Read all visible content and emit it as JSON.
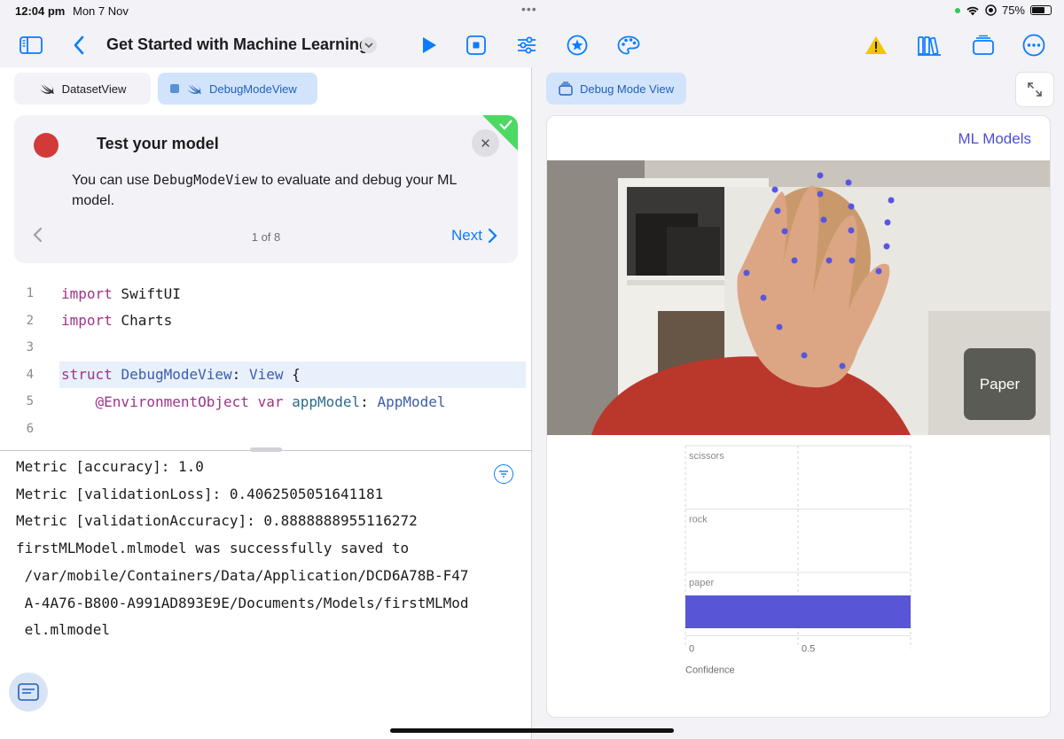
{
  "status": {
    "time": "12:04 pm",
    "date": "Mon 7 Nov",
    "battery": "75%",
    "battery_level": 0.75
  },
  "toolbar": {
    "title": "Get Started with Machine Learning",
    "icons": [
      "sidebar-icon",
      "back-icon",
      "play-icon",
      "stop-icon",
      "sliders-icon",
      "star-icon",
      "palette-icon",
      "warning-icon",
      "library-icon",
      "window-icon",
      "more-icon"
    ],
    "accent": "#0a7cff",
    "warning_color": "#f5c400"
  },
  "tabs": [
    {
      "label": "DatasetView",
      "active": false
    },
    {
      "label": "DebugModeView",
      "active": true
    }
  ],
  "tutorial": {
    "title": "Test your model",
    "body_prefix": "You can use ",
    "body_code": "DebugModeView",
    "body_suffix": " to evaluate and debug your ML model.",
    "page": "1 of 8",
    "next_label": "Next",
    "badge_color": "#4cd964"
  },
  "code_lines": [
    {
      "num": "1",
      "tokens": [
        [
          "kw",
          "import"
        ],
        [
          "",
          " SwiftUI"
        ]
      ]
    },
    {
      "num": "2",
      "tokens": [
        [
          "kw",
          "import"
        ],
        [
          "",
          " Charts"
        ]
      ]
    },
    {
      "num": "3",
      "tokens": []
    },
    {
      "num": "4",
      "highlighted": true,
      "tokens": [
        [
          "kw",
          "struct"
        ],
        [
          "",
          " "
        ],
        [
          "ty",
          "DebugModeView"
        ],
        [
          "",
          ": "
        ],
        [
          "ty",
          "View"
        ],
        [
          "",
          " {"
        ]
      ]
    },
    {
      "num": "5",
      "tokens": [
        [
          "",
          "    "
        ],
        [
          "kw",
          "@EnvironmentObject"
        ],
        [
          "",
          " "
        ],
        [
          "kw",
          "var"
        ],
        [
          "",
          " "
        ],
        [
          "id",
          "appModel"
        ],
        [
          "",
          ": "
        ],
        [
          "ty",
          "AppModel"
        ]
      ]
    },
    {
      "num": "6",
      "tokens": []
    }
  ],
  "console": [
    "Metric [accuracy]: 1.0",
    "Metric [validationLoss]: 0.4062505051641181",
    "Metric [validationAccuracy]: 0.8888888955116272",
    "firstMLModel.mlmodel was successfully saved to",
    " /var/mobile/Containers/Data/Application/DCD6A78B-F47",
    " A-4A76-B800-A991AD893E9E/Documents/Models/firstMLMod",
    " el.mlmodel"
  ],
  "preview": {
    "tab_label": "Debug Mode View",
    "link_label": "ML Models",
    "prediction_label": "Paper"
  },
  "chart_data": {
    "type": "bar",
    "orientation": "horizontal",
    "categories": [
      "scissors",
      "rock",
      "paper"
    ],
    "values": [
      0,
      0,
      1.0
    ],
    "xlabel": "Confidence",
    "xticks": [
      "0",
      "0.5"
    ],
    "xlim": [
      0,
      1
    ],
    "grid": true,
    "bar_color": "#5856d6"
  }
}
